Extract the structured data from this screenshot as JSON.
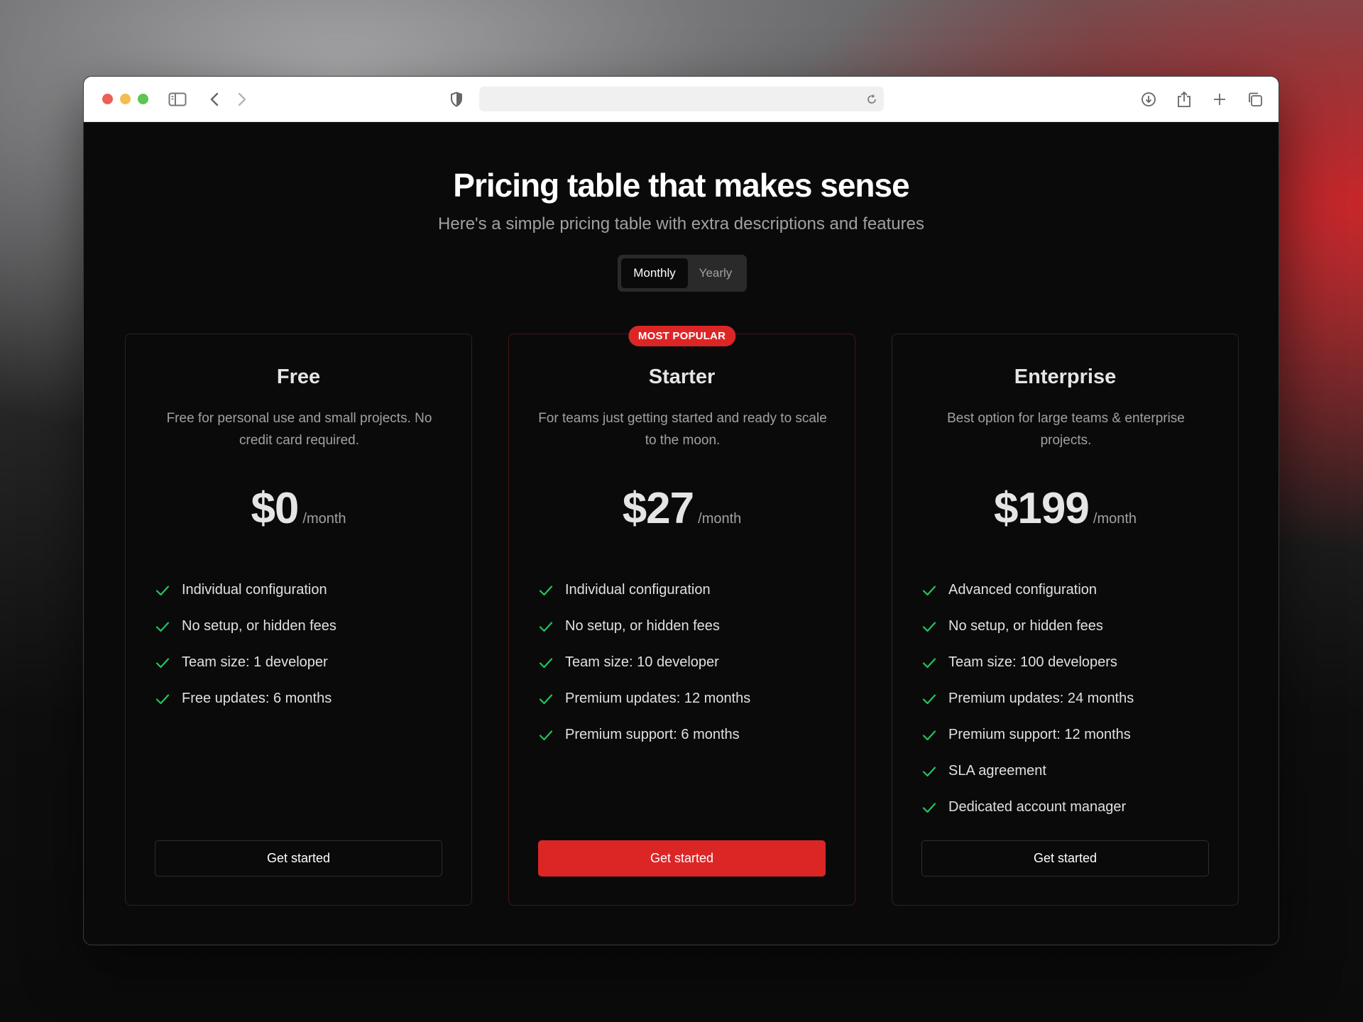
{
  "colors": {
    "accent": "#dc2626",
    "check": "#22c55e",
    "page_bg": "#0a0a0a"
  },
  "browser": {
    "icons": [
      "sidebar-icon",
      "back-icon",
      "forward-icon",
      "shield-icon",
      "reload-icon",
      "download-icon",
      "share-icon",
      "new-tab-icon",
      "tabs-overview-icon"
    ]
  },
  "header": {
    "title": "Pricing table that makes sense",
    "subtitle": "Here's a simple pricing table with extra descriptions and features"
  },
  "billing_toggle": {
    "options": [
      "Monthly",
      "Yearly"
    ],
    "selected": "Monthly"
  },
  "plans": [
    {
      "name": "Free",
      "description": "Free for personal use and small projects. No credit card required.",
      "price": "$0",
      "period": "/month",
      "features": [
        "Individual configuration",
        "No setup, or hidden fees",
        "Team size: 1 developer",
        "Free updates: 6 months"
      ],
      "cta": "Get started"
    },
    {
      "name": "Starter",
      "badge": "MOST POPULAR",
      "description": "For teams just getting started and ready to scale to the moon.",
      "price": "$27",
      "period": "/month",
      "features": [
        "Individual configuration",
        "No setup, or hidden fees",
        "Team size: 10 developer",
        "Premium updates: 12 months",
        "Premium support: 6 months"
      ],
      "cta": "Get started"
    },
    {
      "name": "Enterprise",
      "description": "Best option for large teams & enterprise projects.",
      "price": "$199",
      "period": "/month",
      "features": [
        "Advanced configuration",
        "No setup, or hidden fees",
        "Team size: 100 developers",
        "Premium updates: 24 months",
        "Premium support: 12 months",
        "SLA agreement",
        "Dedicated account manager"
      ],
      "cta": "Get started"
    }
  ]
}
